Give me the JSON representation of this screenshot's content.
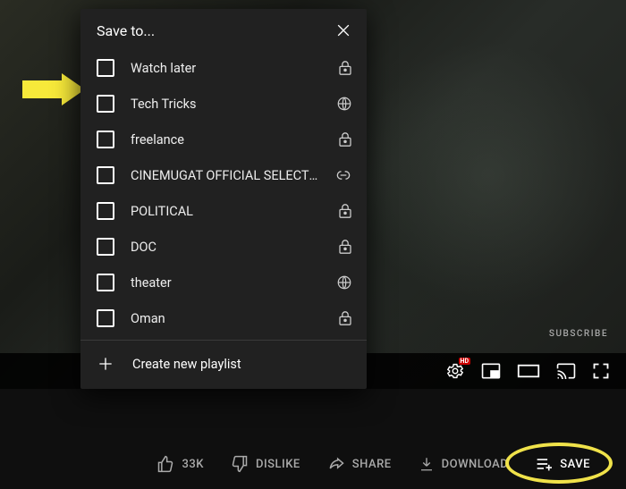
{
  "dialog": {
    "title": "Save to...",
    "create_label": "Create new playlist",
    "playlists": [
      {
        "name": "Watch later",
        "privacy": "private"
      },
      {
        "name": "Tech Tricks",
        "privacy": "public"
      },
      {
        "name": "freelance",
        "privacy": "private"
      },
      {
        "name": "CINEMUGAT OFFICIAL SELECTION",
        "privacy": "unlisted"
      },
      {
        "name": "POLITICAL",
        "privacy": "private"
      },
      {
        "name": "DOC",
        "privacy": "private"
      },
      {
        "name": "theater",
        "privacy": "public"
      },
      {
        "name": "Oman",
        "privacy": "private"
      }
    ]
  },
  "subscribe_label": "SUBSCRIBE",
  "actions": {
    "like_count": "33K",
    "dislike_label": "DISLIKE",
    "share_label": "SHARE",
    "download_label": "DOWNLOAD",
    "save_label": "SAVE"
  },
  "player": {
    "hd_badge": "HD"
  }
}
